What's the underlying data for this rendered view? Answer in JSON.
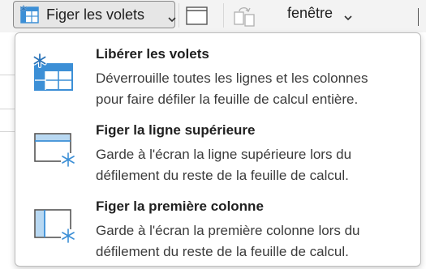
{
  "ribbon": {
    "freeze_button_label": "Figer les volets",
    "window_label": "fenêtre"
  },
  "menu": {
    "items": [
      {
        "title": "Libérer les volets",
        "desc_line1": "Déverrouille toutes les lignes et les colonnes",
        "desc_line2": "pour faire défiler la feuille de calcul entière.",
        "icon": "unfreeze-panes-icon"
      },
      {
        "title": "Figer la ligne supérieure",
        "desc_line1": "Garde à l'écran la ligne supérieure lors du",
        "desc_line2": "défilement du reste de la feuille de calcul.",
        "icon": "freeze-top-row-icon"
      },
      {
        "title": "Figer la première colonne",
        "desc_line1": "Garde à l'écran la première colonne lors du",
        "desc_line2": "défilement du reste de la feuille de calcul.",
        "icon": "freeze-first-column-icon"
      }
    ]
  },
  "colors": {
    "accent_blue": "#3c8fd6",
    "light_blue": "#b8d8f2",
    "border": "#bdbdbd"
  }
}
